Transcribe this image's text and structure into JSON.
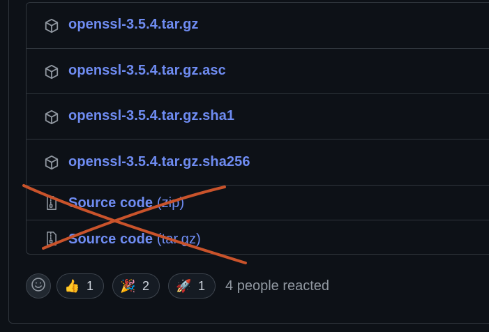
{
  "assets": [
    {
      "name": "openssl-3.5.4.tar.gz",
      "suffix": "",
      "icon": "package-icon"
    },
    {
      "name": "openssl-3.5.4.tar.gz.asc",
      "suffix": "",
      "icon": "package-icon"
    },
    {
      "name": "openssl-3.5.4.tar.gz.sha1",
      "suffix": "",
      "icon": "package-icon"
    },
    {
      "name": "openssl-3.5.4.tar.gz.sha256",
      "suffix": "",
      "icon": "package-icon"
    },
    {
      "name": "Source code",
      "suffix": "(zip)",
      "icon": "file-zip-icon"
    },
    {
      "name": "Source code",
      "suffix": "(tar.gz)",
      "icon": "file-zip-icon"
    }
  ],
  "reactions": {
    "add_icon": "smiley-icon",
    "items": [
      {
        "emoji": "👍",
        "count": "1",
        "icon": "thumbs-up-icon"
      },
      {
        "emoji": "🎉",
        "count": "2",
        "icon": "tada-icon"
      },
      {
        "emoji": "🚀",
        "count": "1",
        "icon": "rocket-icon"
      }
    ],
    "summary": "4 people reacted"
  },
  "colors": {
    "background": "#0d1117",
    "border": "#30363d",
    "link": "#6f8cf2",
    "annotation_stroke": "#c9532b"
  }
}
